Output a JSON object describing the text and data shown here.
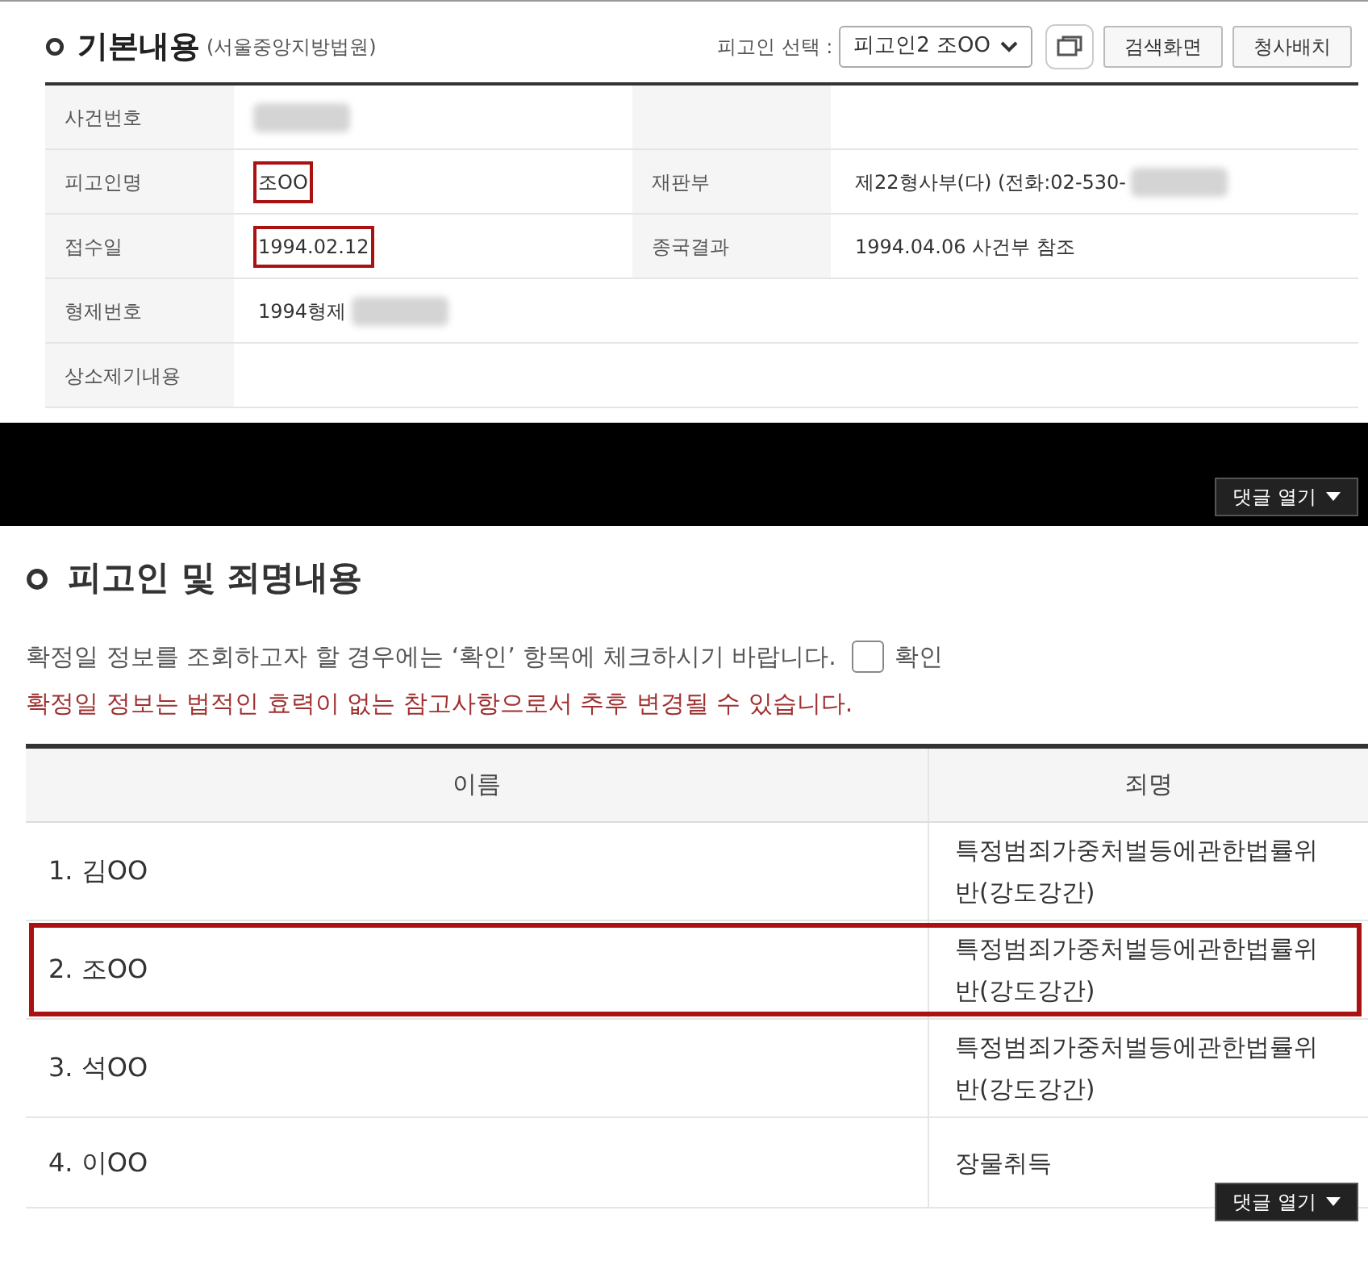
{
  "basic_info": {
    "title": "기본내용",
    "court": "(서울중앙지방법원)",
    "defendant_select": {
      "label": "피고인 선택 :",
      "value": "피고인2 조OO"
    },
    "buttons": [
      "검색화면",
      "청사배치"
    ],
    "rows": [
      [
        {
          "label": "사건번호",
          "redacted": true
        },
        {
          "kind": "blank"
        }
      ],
      [
        {
          "label": "피고인명",
          "value": "조OO",
          "redacted": false,
          "highlighted": true
        },
        {
          "label": "재판부",
          "value": "제22형사부(다) (전화:02-530-",
          "redacted": true,
          "highlighted": false
        }
      ],
      [
        {
          "label": "접수일",
          "value": "1994.02.12",
          "redacted": false,
          "highlighted": true
        },
        {
          "label": "종국결과",
          "value": "1994.04.06 사건부 참조",
          "redacted": false,
          "highlighted": false
        }
      ],
      [
        {
          "label": "형제번호",
          "value": "1994형제",
          "redacted": true,
          "highlighted": false
        }
      ],
      [
        {
          "label": "상소제기내용"
        }
      ]
    ]
  },
  "charges": {
    "title": "피고인 및 죄명내용",
    "notice": "확정일 정보를 조회하고자 할 경우에는 ‘확인’ 항목에 체크하시기 바랍니다.",
    "confirm": {
      "label": "확인",
      "checked": false
    },
    "warning": "확정일 정보는 법적인 효력이 없는 참고사항으로서 추후 변경될 수 있습니다.",
    "columns": [
      "이름",
      "죄명"
    ],
    "rows": [
      {
        "name": "1. 김OO",
        "charge": "특정범죄가중처벌등에관한법률위반(강도강간)",
        "highlighted": false
      },
      {
        "name": "2. 조OO",
        "charge": "특정범죄가중처벌등에관한법률위반(강도강간)",
        "highlighted": true
      },
      {
        "name": "3. 석OO",
        "charge": "특정범죄가중처벌등에관한법률위반(강도강간)",
        "highlighted": false
      },
      {
        "name": "4. 이OO",
        "charge": "장물취득",
        "highlighted": false
      }
    ]
  },
  "comment_buttons": [
    {
      "label": "댓글 열기"
    },
    {
      "label": "댓글 열기"
    }
  ]
}
